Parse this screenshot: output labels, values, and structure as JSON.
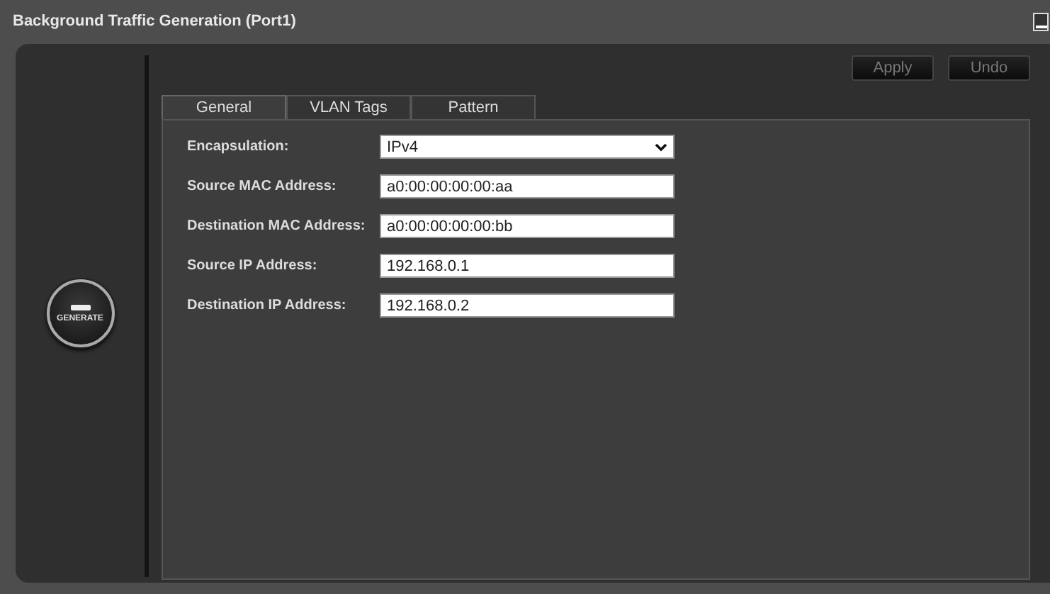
{
  "window": {
    "title": "Background Traffic Generation (Port1)"
  },
  "generate_button": {
    "label": "GENERATE"
  },
  "actions": [
    {
      "label": "Apply",
      "disabled": true
    },
    {
      "label": "Undo",
      "disabled": true
    }
  ],
  "tabs": [
    {
      "label": "General",
      "selected": true
    },
    {
      "label": "VLAN Tags",
      "selected": false
    },
    {
      "label": "Pattern",
      "selected": false
    }
  ],
  "fields": [
    {
      "label": "Encapsulation:",
      "kind": "select",
      "value": "IPv4"
    },
    {
      "label": "Source MAC Address:",
      "kind": "text",
      "value": "a0:00:00:00:00:aa"
    },
    {
      "label": "Destination MAC Address:",
      "kind": "text",
      "value": "a0:00:00:00:00:bb"
    },
    {
      "label": "Source IP Address:",
      "kind": "text",
      "value": "192.168.0.1"
    },
    {
      "label": "Destination IP Address:",
      "kind": "text",
      "value": "192.168.0.2"
    }
  ]
}
